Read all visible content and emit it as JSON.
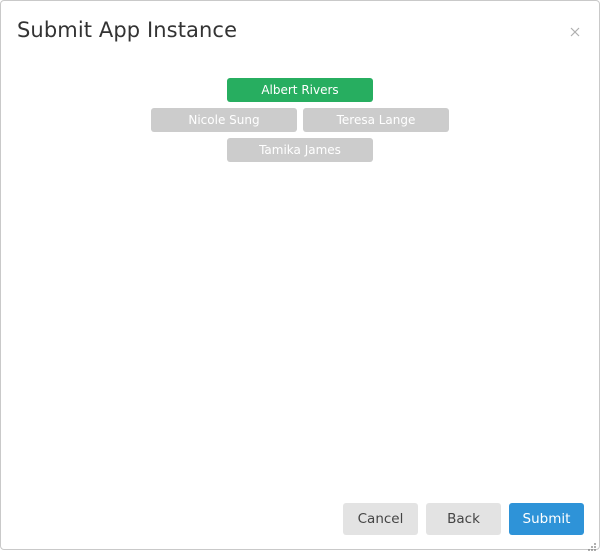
{
  "dialog": {
    "title": "Submit App Instance"
  },
  "recipients": [
    {
      "label": "Albert Rivers",
      "selected": true
    },
    {
      "label": "Nicole Sung",
      "selected": false
    },
    {
      "label": "Teresa Lange",
      "selected": false
    },
    {
      "label": "Tamika James",
      "selected": false
    }
  ],
  "footer": {
    "cancel_label": "Cancel",
    "back_label": "Back",
    "submit_label": "Submit"
  },
  "icons": {
    "close": "close-icon",
    "resize": "resize-grip-icon"
  },
  "colors": {
    "selected_chip": "#27ae60",
    "unselected_chip": "#cccccc",
    "primary_button": "#2e93d8",
    "secondary_button": "#e3e3e3"
  }
}
